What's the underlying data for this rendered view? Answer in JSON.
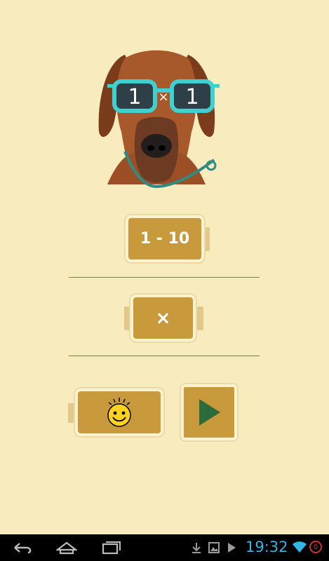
{
  "logo": {
    "left_number": "1",
    "operator": "×",
    "right_number": "1"
  },
  "buttons": {
    "range_label": "1 - 10",
    "operator_label": "×",
    "mood_icon": "smiley-face-icon",
    "play_icon": "play-icon"
  },
  "colors": {
    "background": "#f8ebbd",
    "button_fill": "#c99a3b",
    "button_border": "#fdf3d0",
    "divider": "#3d8f8f",
    "play_triangle": "#2e6b3a",
    "glasses": "#3fd0cf",
    "clock": "#33b5e5"
  },
  "status_bar": {
    "time": "19:32",
    "notification_count": "0",
    "icons": [
      "download-icon",
      "gallery-icon",
      "play-store-icon",
      "wifi-icon",
      "notification-badge"
    ]
  },
  "nav_bar": {
    "icons": [
      "back-icon",
      "home-icon",
      "recent-apps-icon"
    ]
  }
}
